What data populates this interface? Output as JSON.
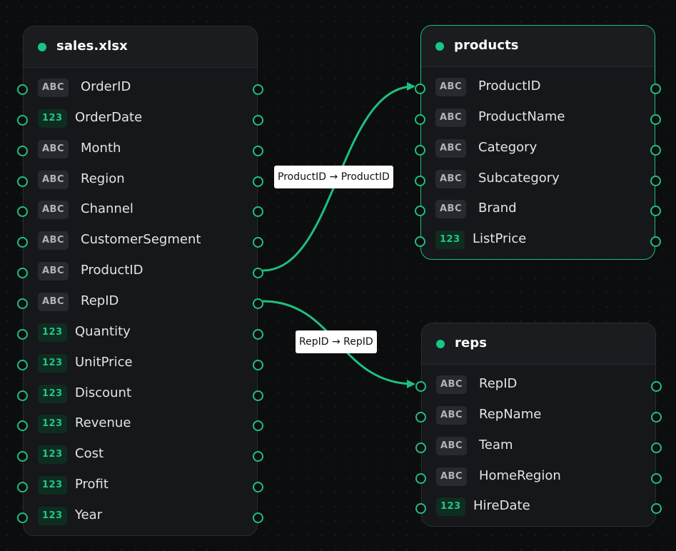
{
  "colors": {
    "accent": "#1fbf7e",
    "canvas": "#0c0d0f",
    "node": "#15171a"
  },
  "icons": {
    "status": "green-status-dot",
    "port": "connector-port-circle"
  },
  "tables": {
    "sales": {
      "title": "sales.xlsx",
      "fields": [
        {
          "type": "ABC",
          "name": "OrderID"
        },
        {
          "type": "123",
          "name": "OrderDate"
        },
        {
          "type": "ABC",
          "name": "Month"
        },
        {
          "type": "ABC",
          "name": "Region"
        },
        {
          "type": "ABC",
          "name": "Channel"
        },
        {
          "type": "ABC",
          "name": "CustomerSegment"
        },
        {
          "type": "ABC",
          "name": "ProductID"
        },
        {
          "type": "ABC",
          "name": "RepID"
        },
        {
          "type": "123",
          "name": "Quantity"
        },
        {
          "type": "123",
          "name": "UnitPrice"
        },
        {
          "type": "123",
          "name": "Discount"
        },
        {
          "type": "123",
          "name": "Revenue"
        },
        {
          "type": "123",
          "name": "Cost"
        },
        {
          "type": "123",
          "name": "Profit"
        },
        {
          "type": "123",
          "name": "Year"
        }
      ]
    },
    "products": {
      "title": "products",
      "fields": [
        {
          "type": "ABC",
          "name": "ProductID"
        },
        {
          "type": "ABC",
          "name": "ProductName"
        },
        {
          "type": "ABC",
          "name": "Category"
        },
        {
          "type": "ABC",
          "name": "Subcategory"
        },
        {
          "type": "ABC",
          "name": "Brand"
        },
        {
          "type": "123",
          "name": "ListPrice"
        }
      ]
    },
    "reps": {
      "title": "reps",
      "fields": [
        {
          "type": "ABC",
          "name": "RepID"
        },
        {
          "type": "ABC",
          "name": "RepName"
        },
        {
          "type": "ABC",
          "name": "Team"
        },
        {
          "type": "ABC",
          "name": "HomeRegion"
        },
        {
          "type": "123",
          "name": "HireDate"
        }
      ]
    }
  },
  "relations": [
    {
      "label": "ProductID → ProductID"
    },
    {
      "label": "RepID → RepID"
    }
  ]
}
